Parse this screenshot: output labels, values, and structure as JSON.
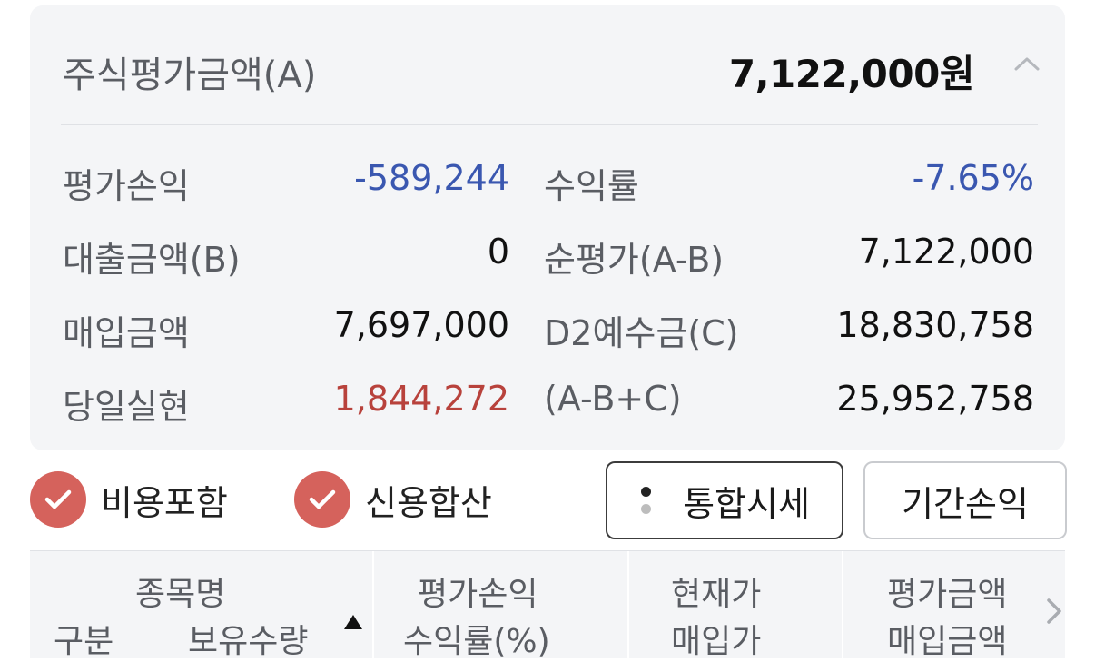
{
  "summary": {
    "label": "주식평가금액(A)",
    "value": "7,122,000원"
  },
  "rows": [
    {
      "l1": "평가손익",
      "v1": "-589,244",
      "l2": "수익률",
      "v2": "-7.65%"
    },
    {
      "l1": "대출금액(B)",
      "v1": "0",
      "l2": "순평가(A-B)",
      "v2": "7,122,000"
    },
    {
      "l1": "매입금액",
      "v1": "7,697,000",
      "l2": "D2예수금(C)",
      "v2": "18,830,758"
    },
    {
      "l1": "당일실현",
      "v1": "1,844,272",
      "l2": "(A-B+C)",
      "v2": "25,952,758"
    }
  ],
  "options": {
    "include_fees": "비용포함",
    "credit_sum": "신용합산"
  },
  "buttons": {
    "integrated_price": "통합시세",
    "period_pnl": "기간손익"
  },
  "table_header": {
    "col1_top": "종목명",
    "col1_left": "구분",
    "col1_right": "보유수량",
    "col2_top": "평가손익",
    "col2_bottom": "수익률(%)",
    "col3_top": "현재가",
    "col3_bottom": "매입가",
    "col4_top": "평가금액",
    "col4_bottom": "매입금액"
  },
  "colors": {
    "negative": "#3a57b0",
    "positive": "#b8423c",
    "check_fill": "#d5625c",
    "card_bg": "#f4f5f7"
  },
  "icons": [
    "chevron-up-icon",
    "checkmark-icon",
    "menu-dots-icon",
    "sort-ascending-icon",
    "chevron-right-icon"
  ]
}
